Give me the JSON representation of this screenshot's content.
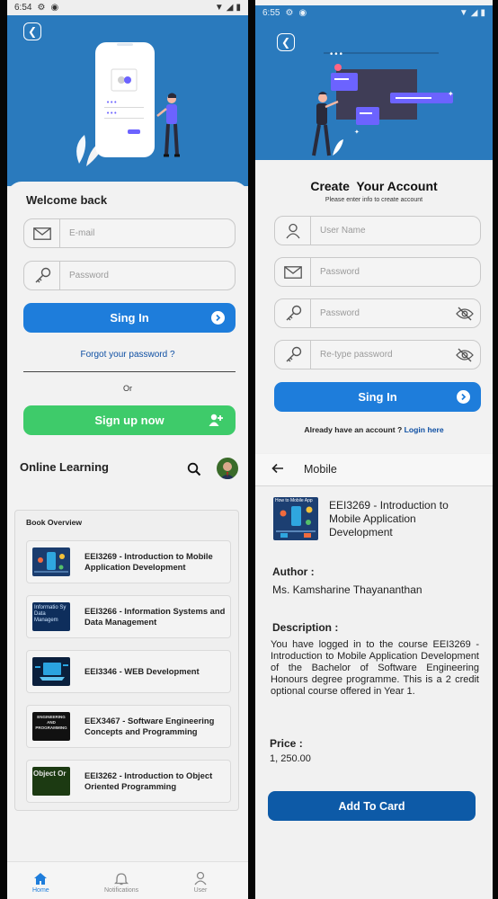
{
  "left": {
    "status": {
      "time": "6:54"
    },
    "login": {
      "title": "Welcome back",
      "email_placeholder": "E-mail",
      "password_placeholder": "Password",
      "signin_label": "Sing In",
      "forgot_label": "Forgot your password ?",
      "or_label": "Or",
      "signup_label": "Sign up now"
    },
    "learning": {
      "title": "Online Learning",
      "section_title": "Book Overview",
      "books": [
        {
          "title": "EEI3269 - Introduction to Mobile Application Development",
          "thumb_text": ""
        },
        {
          "title": "EEI3266 - Information Systems and Data Management",
          "thumb_text": "Informatio Sy Data Managem"
        },
        {
          "title": "EEI3346 - WEB Development",
          "thumb_text": ""
        },
        {
          "title": "EEX3467 - Software Engineering Concepts and Programming",
          "thumb_text": "ENGINEERING AND PROGRAMMING"
        },
        {
          "title": "EEI3262 - Introduction to Object Oriented Programming",
          "thumb_text": "Object Or"
        }
      ]
    },
    "nav": [
      {
        "label": "Home",
        "active": true,
        "icon": "home-icon"
      },
      {
        "label": "Notifications",
        "active": false,
        "icon": "bell-icon"
      },
      {
        "label": "User",
        "active": false,
        "icon": "user-icon"
      }
    ]
  },
  "right": {
    "status": {
      "time": "6:55"
    },
    "signup": {
      "title": "Create  Your Account",
      "subtitle": "Please enter info to create account",
      "username_placeholder": "User Name",
      "email_placeholder": "Password",
      "password_placeholder": "Password",
      "retype_placeholder": "Re-type password",
      "signin_label": "Sing In",
      "already_label": "Already have an account ?",
      "login_link": "Login here"
    },
    "detail": {
      "header_title": "Mobile",
      "thumb_label": "How to Mobile App",
      "course_title": "EEI3269 - Introduction to Mobile Application Development",
      "author_heading": "Author :",
      "author_name": "Ms. Kamsharine Thayananthan",
      "description_heading": "Description :",
      "description": "You have logged in to the course EEI3269 - Introduction to Mobile Application Development of the Bachelor of Software Engineering Honours degree programme. This is a 2 credit optional course offered in Year 1.",
      "price_heading": "Price :",
      "price_value": "1, 250.00",
      "add_button": "Add To Card"
    }
  },
  "colors": {
    "primary_blue": "#2a7abd",
    "button_blue": "#1e7ddb",
    "signup_green": "#3ecb6a",
    "link_blue": "#0e4fa3",
    "add_button": "#0d5aa7"
  }
}
